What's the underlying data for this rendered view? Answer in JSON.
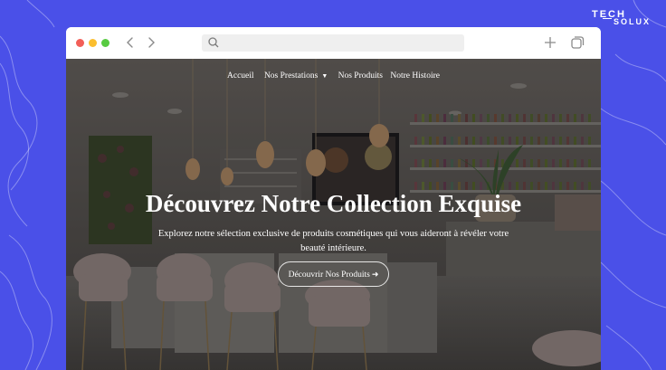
{
  "brand": {
    "line1": "TECH",
    "line2": "SOLUX"
  },
  "browser": {
    "url": ""
  },
  "site_nav": {
    "items": [
      {
        "label": "Accueil"
      },
      {
        "label": "Nos Prestations",
        "has_dropdown": true
      },
      {
        "label": "Nos Produits"
      },
      {
        "label": "Notre Histoire"
      }
    ]
  },
  "hero": {
    "title": "Découvrez Notre Collection Exquise",
    "subtitle": "Explorez notre sélection exclusive de produits cosmétiques qui vous aideront à révéler votre beauté intérieure.",
    "cta_label": "Découvrir Nos Produits",
    "cta_icon": "arrow-right-icon"
  },
  "colors": {
    "page_bg": "#4a50e8",
    "window_bg": "#ffffff",
    "traffic_red": "#f25f58",
    "traffic_yellow": "#fbbe2e",
    "traffic_green": "#58cb42"
  }
}
